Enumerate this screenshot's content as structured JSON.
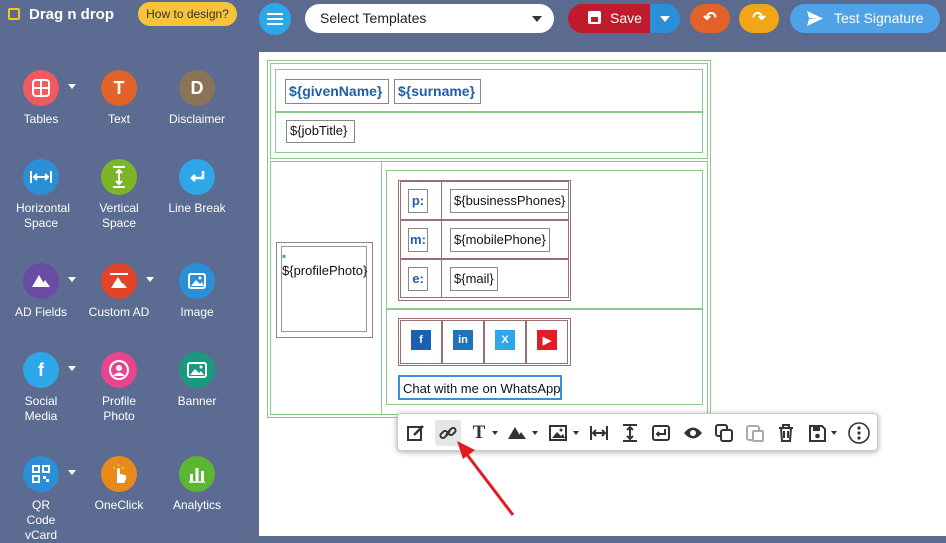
{
  "sidebar": {
    "title": "Drag n drop",
    "howto_label": "How to design?",
    "tools": [
      {
        "label": "Tables",
        "icon": "table-icon",
        "color": "#ef5a5f"
      },
      {
        "label": "Text",
        "icon": "text-icon",
        "glyph": "T",
        "color": "#e2622a"
      },
      {
        "label": "Disclaimer",
        "icon": "disclaimer-icon",
        "glyph": "D",
        "color": "#8a7356"
      },
      {
        "label": "Horizontal Space",
        "icon": "horizontal-space-icon",
        "color": "#2a8fd6"
      },
      {
        "label": "Vertical Space",
        "icon": "vertical-space-icon",
        "color": "#7cb526"
      },
      {
        "label": "Line Break",
        "icon": "line-break-icon",
        "color": "#2ea7e8"
      },
      {
        "label": "AD Fields",
        "icon": "ad-fields-icon",
        "color": "#6a4ba3"
      },
      {
        "label": "Custom AD",
        "icon": "custom-ad-icon",
        "color": "#e2442a"
      },
      {
        "label": "Image",
        "icon": "image-icon",
        "color": "#2a8fd6"
      },
      {
        "label": "Social Media",
        "icon": "social-media-icon",
        "glyph": "f",
        "color": "#2ea7e8"
      },
      {
        "label": "Profile Photo",
        "icon": "profile-photo-icon",
        "color": "#e8458f"
      },
      {
        "label": "Banner",
        "icon": "banner-icon",
        "color": "#1a9a7c"
      },
      {
        "label": "QR Code vCard",
        "icon": "qr-code-icon",
        "color": "#2a8fd6"
      },
      {
        "label": "OneClick",
        "icon": "oneclick-icon",
        "color": "#e88a1a"
      },
      {
        "label": "Analytics",
        "icon": "analytics-icon",
        "color": "#5cb533"
      }
    ]
  },
  "topbar": {
    "template_select": "Select Templates",
    "save_label": "Save",
    "test_label": "Test Signature"
  },
  "signature": {
    "given_name": "${givenName}",
    "surname": "${surname}",
    "job_title": "${jobTitle}",
    "profile_photo": "${profilePhoto}",
    "contacts": [
      {
        "label": "p:",
        "value": "${businessPhones}"
      },
      {
        "label": "m:",
        "value": "${mobilePhone}"
      },
      {
        "label": "e:",
        "value": "${mail}"
      }
    ],
    "social": [
      {
        "name": "facebook-icon",
        "glyph": "f",
        "color": "#1a5fb4"
      },
      {
        "name": "linkedin-icon",
        "glyph": "in",
        "color": "#1f73b7"
      },
      {
        "name": "twitter-icon",
        "glyph": "X",
        "color": "#2ea7e8"
      },
      {
        "name": "youtube-icon",
        "glyph": "▶",
        "color": "#e21c24"
      }
    ],
    "whatsapp_label": "Chat with me on WhatsApp"
  }
}
